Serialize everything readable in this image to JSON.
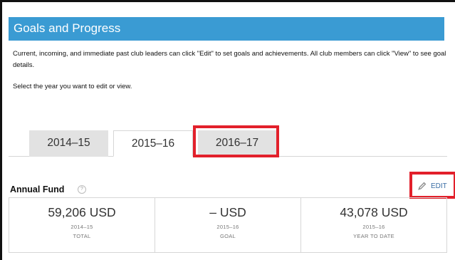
{
  "panel": {
    "title": "Goals and Progress"
  },
  "intro": {
    "line1": "Current, incoming, and immediate past club leaders can click \"Edit\" to set goals and achievements. All club members can click \"View\" to see goal details.",
    "select_prompt": "Select the year you want to edit or view."
  },
  "tabs": [
    {
      "label": "2014–15",
      "selected": false
    },
    {
      "label": "2015–16",
      "selected": true
    },
    {
      "label": "2016–17",
      "selected": false,
      "highlighted": true
    }
  ],
  "annual_fund": {
    "title": "Annual Fund",
    "help_icon": "help-circle-icon",
    "edit": {
      "label": "EDIT",
      "icon": "pencil-icon",
      "highlighted": true
    },
    "stats": [
      {
        "value": "59,206 USD",
        "year": "2014–15",
        "caption": "TOTAL"
      },
      {
        "value": "– USD",
        "year": "2015–16",
        "caption": "GOAL"
      },
      {
        "value": "43,078 USD",
        "year": "2015–16",
        "caption": "YEAR TO DATE"
      }
    ]
  },
  "colors": {
    "header_bg": "#3a9bd3",
    "highlight": "#e2202b",
    "link": "#3a6ea5"
  }
}
